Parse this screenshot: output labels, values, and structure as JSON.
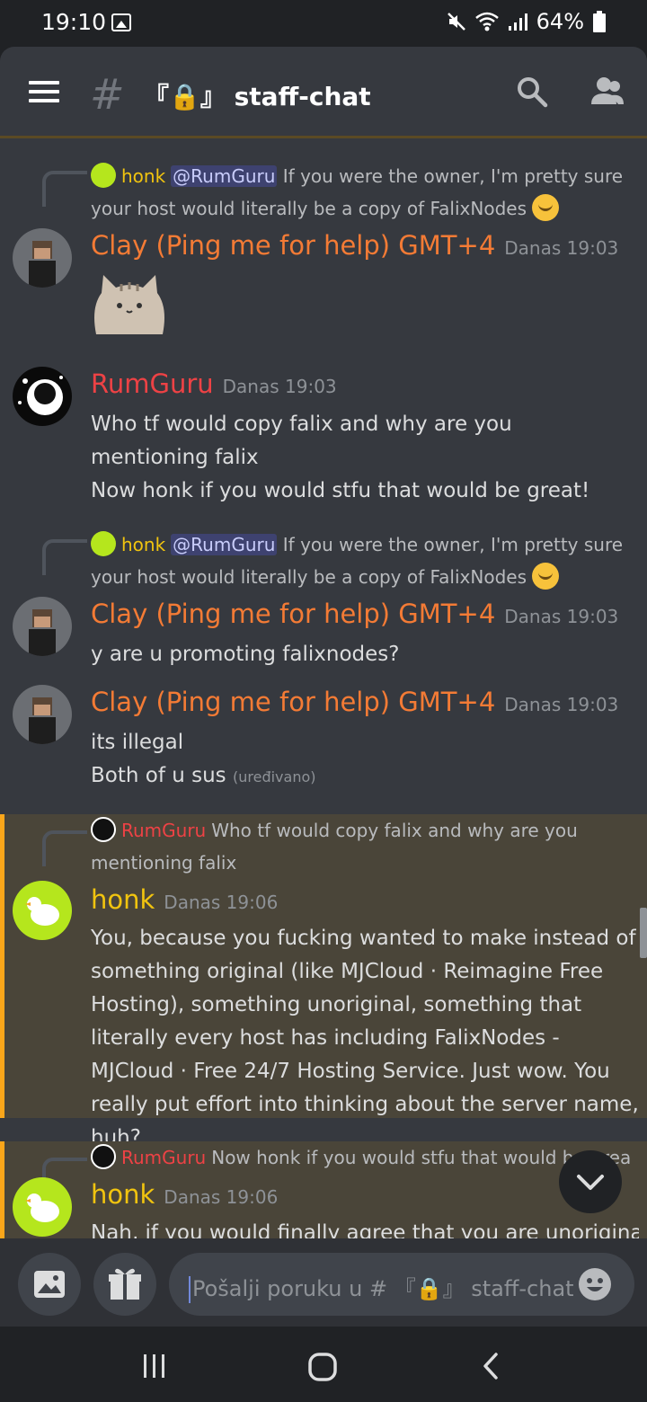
{
  "status_bar": {
    "time": "19:10",
    "battery": "64%",
    "icons": [
      "gallery-icon",
      "mute-icon",
      "wifi-icon",
      "signal-icon",
      "battery-icon"
    ]
  },
  "header": {
    "channel_prefix": "『🔒』",
    "channel_name": "staff-chat",
    "icons": [
      "menu-icon",
      "hash-icon",
      "search-icon",
      "members-icon"
    ]
  },
  "messages": [
    {
      "reply": {
        "author": "honk",
        "mention": "@RumGuru",
        "text": "If you were the owner, I'm pretty sure your host would literally be a copy of FalixNodes"
      },
      "author": "Clay (Ping me for help) GMT+4",
      "timestamp": "Danas 19:03",
      "content": "",
      "sticker": "pusheen-sticker"
    },
    {
      "author": "RumGuru",
      "timestamp": "Danas 19:03",
      "content_lines": [
        "Who tf would copy falix and why are you mentioning falix",
        "Now honk if you would stfu that would be great!"
      ]
    },
    {
      "reply": {
        "author": "honk",
        "mention": "@RumGuru",
        "text": "If you were the owner, I'm pretty sure your host would literally be a copy of FalixNodes"
      },
      "author": "Clay (Ping me for help) GMT+4",
      "timestamp": "Danas 19:03",
      "content": "y are u promoting falixnodes?"
    },
    {
      "author": "Clay (Ping me for help) GMT+4",
      "timestamp": "Danas 19:03",
      "content_lines": [
        "its illegal",
        "Both of u sus"
      ],
      "edited": "(uređivano)"
    },
    {
      "reply": {
        "author": "RumGuru",
        "text": "Who tf would copy falix and why are you mentioning falix"
      },
      "author": "honk",
      "timestamp": "Danas 19:06",
      "content": "You, because you fucking wanted to make instead of something original (like MJCloud · Reimagine Free Hosting), something unoriginal, something that literally every host has including FalixNodes - MJCloud · Free 24/7 Hosting Service. Just wow. You really put effort into thinking about the server name, huh?"
    },
    {
      "reply": {
        "author": "RumGuru",
        "text": "Now honk if you would stfu that would be great!"
      },
      "author": "honk",
      "timestamp": "Danas 19:06",
      "content": "Nah, if you would finally agree that you are unoriginal I"
    }
  ],
  "composer": {
    "placeholder": "Pošalji poruku u # 『🔒』 staff-chat",
    "icons": [
      "image-icon",
      "gift-icon",
      "emoji-icon"
    ]
  },
  "nav": {
    "icons": [
      "recent-apps-icon",
      "home-icon",
      "back-icon"
    ]
  },
  "colors": {
    "accent_mention": "#faa61a",
    "clay": "#f47b35",
    "rumguru": "#ed4245",
    "honk": "#f1c40f"
  }
}
